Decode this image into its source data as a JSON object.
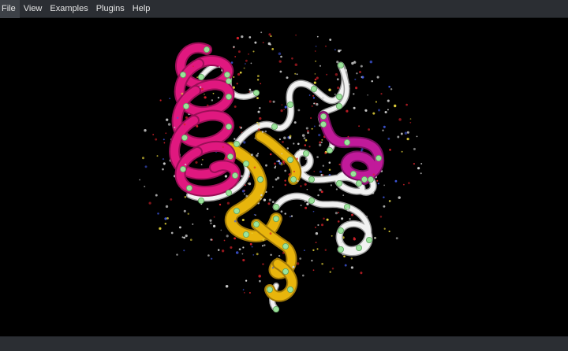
{
  "menu": {
    "file": "File",
    "view": "View",
    "examples": "Examples",
    "plugins": "Plugins",
    "help": "Help"
  },
  "viewport": {
    "representation": "cartoon-ribbon",
    "background_color": "#000000",
    "colors": {
      "helix": "#e0187f",
      "helix_dark": "#9a0f57",
      "sheet": "#e8b50c",
      "sheet_dark": "#a27a08",
      "coil": "#f2f2f2",
      "coil_dark": "#9a9a9a",
      "calpha_atom": "#9be39b",
      "water_oxygen": "#d8212a",
      "nitrogen_atom": "#3f58e0",
      "hydrogen_atom": "#cfcfcf",
      "sulfur_atom": "#e3d23a"
    }
  },
  "statusbar": {}
}
